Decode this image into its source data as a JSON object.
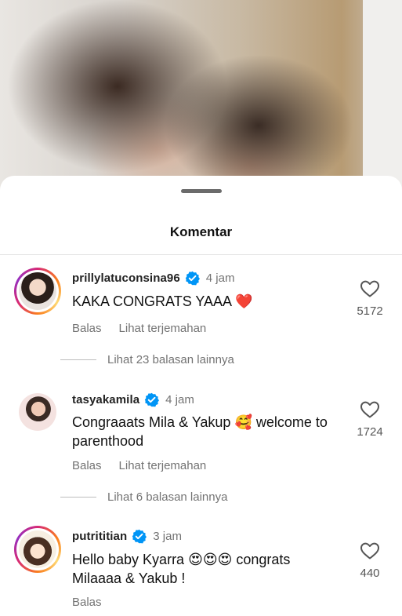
{
  "sheet": {
    "title": "Komentar"
  },
  "comments": [
    {
      "username": "prillylatuconsina96",
      "time": "4 jam",
      "text": "KAKA CONGRATS YAAA ❤️",
      "likes": "5172",
      "reply_label": "Balas",
      "translate_label": "Lihat terjemahan",
      "view_replies": "Lihat 23 balasan lainnya",
      "verified": true,
      "avatar_icon": "profile-photo"
    },
    {
      "username": "tasyakamila",
      "time": "4 jam",
      "text": "Congraaats Mila & Yakup 🥰 welcome to parenthood",
      "likes": "1724",
      "reply_label": "Balas",
      "translate_label": "Lihat terjemahan",
      "view_replies": "Lihat 6 balasan lainnya",
      "verified": true,
      "avatar_icon": "profile-photo"
    },
    {
      "username": "putrititian",
      "time": "3 jam",
      "text": "Hello baby Kyarra 😍😍😍 congrats Milaaaa & Yakub !",
      "likes": "440",
      "reply_label": "Balas",
      "verified": true,
      "avatar_icon": "profile-cartoon"
    }
  ],
  "colors": {
    "verified": "#0095f6",
    "muted": "#737373",
    "text": "#111111"
  }
}
